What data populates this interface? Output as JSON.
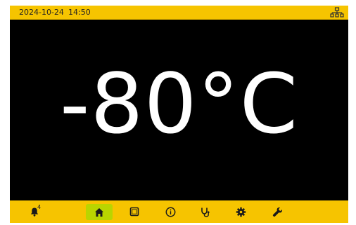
{
  "status_bar": {
    "date": "2024-10-24",
    "time": "14:50",
    "network_icon": "network-icon"
  },
  "main": {
    "temperature": "-80°C"
  },
  "nav_bar": {
    "alarm_count": "4",
    "items": [
      {
        "icon": "bell-icon"
      },
      {
        "icon": "home-icon",
        "active": true
      },
      {
        "icon": "square-icon"
      },
      {
        "icon": "info-icon"
      },
      {
        "icon": "stethoscope-icon"
      },
      {
        "icon": "gear-icon"
      },
      {
        "icon": "wrench-icon"
      }
    ]
  },
  "colors": {
    "bar": "#f6c400",
    "active_tab": "#b9d500",
    "display_bg": "#000000",
    "display_text": "#ffffff"
  }
}
